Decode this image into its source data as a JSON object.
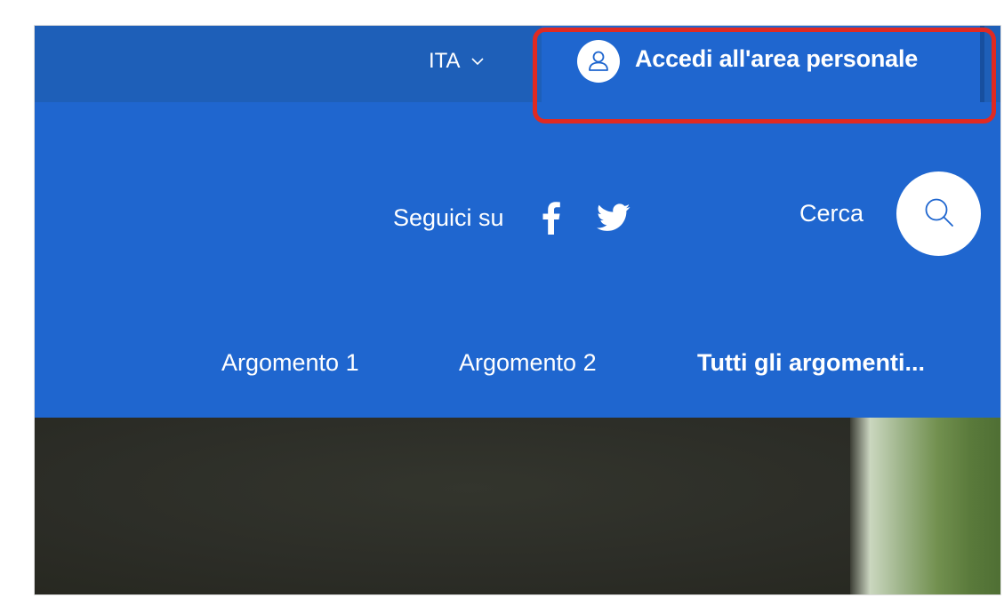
{
  "header": {
    "language": {
      "label": "ITA",
      "chevron_icon": "chevron-down-icon"
    },
    "login": {
      "label": "Accedi all'area personale",
      "icon": "user-icon"
    }
  },
  "center": {
    "social": {
      "label": "Seguici su",
      "links": [
        {
          "icon": "facebook-icon"
        },
        {
          "icon": "twitter-icon"
        }
      ]
    },
    "search": {
      "label": "Cerca",
      "icon": "search-icon"
    }
  },
  "topics": {
    "items": [
      "Argomento 1",
      "Argomento 2"
    ],
    "all_label": "Tutti gli argomenti..."
  },
  "colors": {
    "slim_header_bg": "#1e5fb8",
    "header_bg": "#1f66cf",
    "highlight": "#e02a22",
    "text": "#ffffff"
  }
}
